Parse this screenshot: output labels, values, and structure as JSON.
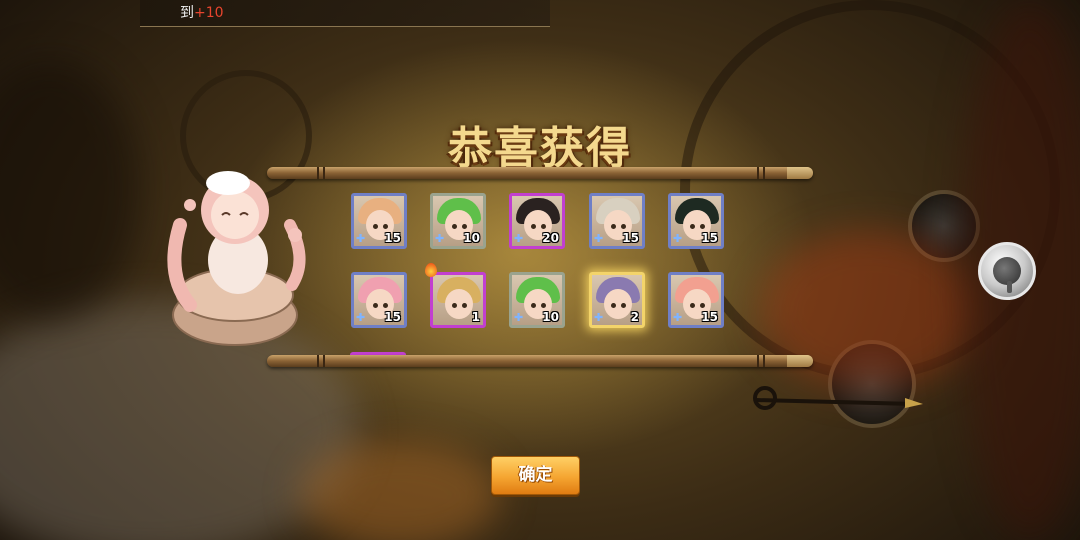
{
  "notice": {
    "prefix": "到",
    "value": "+10"
  },
  "title": "恭喜获得",
  "rewards": [
    {
      "counter": "15",
      "rarity": "blue",
      "hair": "#e8b080",
      "fragment": true
    },
    {
      "counter": "10",
      "rarity": "green",
      "hair": "#5fbf4a",
      "fragment": true
    },
    {
      "counter": "20",
      "rarity": "purple",
      "hair": "#2a2220",
      "fragment": true
    },
    {
      "counter": "15",
      "rarity": "blue",
      "hair": "#d8d0c0",
      "fragment": true
    },
    {
      "counter": "15",
      "rarity": "blue",
      "hair": "#1e2a22",
      "fragment": true
    },
    {
      "counter": "15",
      "rarity": "blue",
      "hair": "#f0a0b0",
      "fragment": true
    },
    {
      "counter": "1",
      "rarity": "purple",
      "hair": "#d8b060",
      "fragment": false
    },
    {
      "counter": "10",
      "rarity": "green",
      "hair": "#5fbf4a",
      "fragment": true
    },
    {
      "counter": "2",
      "rarity": "gold",
      "hair": "#8a7ab0",
      "fragment": true
    },
    {
      "counter": "15",
      "rarity": "blue",
      "hair": "#f2a090",
      "fragment": true
    }
  ],
  "confirm_label": "确定",
  "colors": {
    "accent": "#f5a531",
    "title": "#f4d98e"
  },
  "icons": {
    "side_button": "magnifier-icon",
    "hot": "flame-icon"
  }
}
